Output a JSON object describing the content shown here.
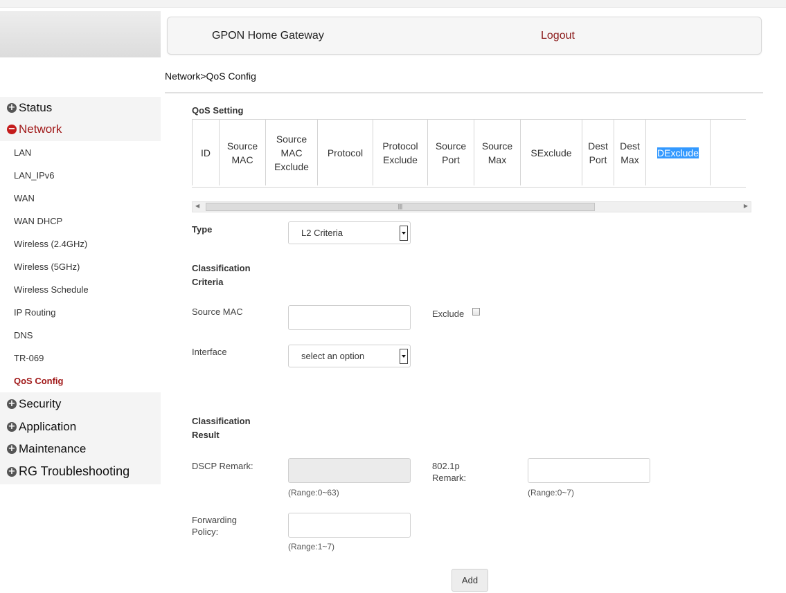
{
  "header": {
    "title": "GPON Home Gateway",
    "logout": "Logout"
  },
  "breadcrumb": "Network>QoS Config",
  "sidebar": {
    "main": [
      {
        "label": "Status",
        "symbol": "+"
      },
      {
        "label": "Network",
        "symbol": "−"
      },
      {
        "label": "Security",
        "symbol": "+"
      },
      {
        "label": "Application",
        "symbol": "+"
      },
      {
        "label": "Maintenance",
        "symbol": "+"
      },
      {
        "label": "RG Troubleshooting",
        "symbol": "+"
      }
    ],
    "network_items": [
      "LAN",
      "LAN_IPv6",
      "WAN",
      "WAN DHCP",
      "Wireless (2.4GHz)",
      "Wireless (5GHz)",
      "Wireless Schedule",
      "IP Routing",
      "DNS",
      "TR-069",
      "QoS Config"
    ],
    "selected_item": "QoS Config"
  },
  "qos_setting": {
    "title": "QoS Setting",
    "columns": [
      [
        "ID"
      ],
      [
        "Source",
        "MAC"
      ],
      [
        "Source",
        "MAC",
        "Exclude"
      ],
      [
        "Protocol"
      ],
      [
        "Protocol",
        "Exclude"
      ],
      [
        "Source",
        "Port"
      ],
      [
        "Source",
        "Max"
      ],
      [
        "SExclude"
      ],
      [
        "Dest",
        "Port"
      ],
      [
        "Dest",
        "Max"
      ],
      [
        "DExclude"
      ]
    ]
  },
  "form": {
    "type_label": "Type",
    "type_value": "L2 Criteria",
    "criteria_title": [
      "Classification",
      "Criteria"
    ],
    "source_mac_label": "Source MAC",
    "exclude_label": "Exclude",
    "interface_label": "Interface",
    "interface_value": "select an option",
    "result_title": [
      "Classification",
      "Result"
    ],
    "dscp_label": "DSCP Remark:",
    "dscp_hint": "(Range:0~63)",
    "p8021_label": [
      "802.1p",
      "Remark:"
    ],
    "p8021_hint": "(Range:0~7)",
    "fwd_label": [
      "Forwarding",
      "Policy:"
    ],
    "fwd_hint": "(Range:1~7)",
    "add_button": "Add"
  }
}
